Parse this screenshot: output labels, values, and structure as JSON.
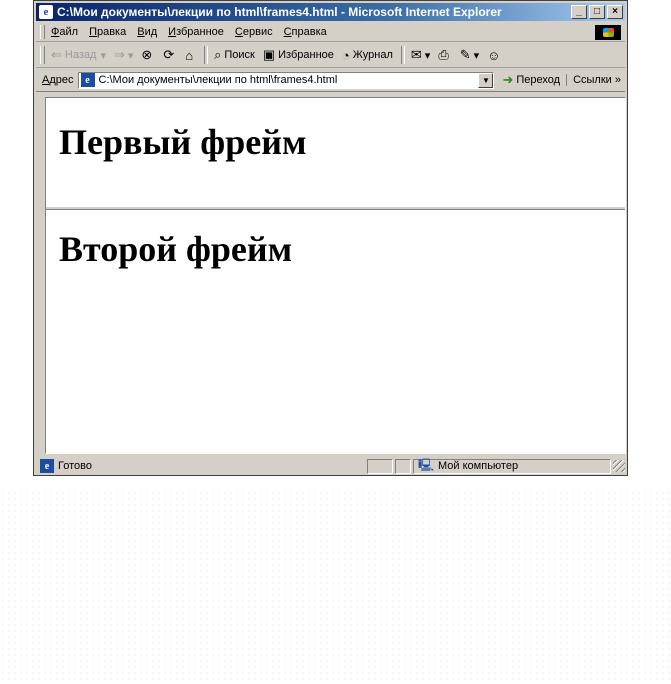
{
  "window": {
    "title": "C:\\Мои документы\\лекции по html\\frames4.html - Microsoft Internet Explorer",
    "controls": {
      "minimize": "_",
      "maximize": "□",
      "close": "×"
    }
  },
  "menu": {
    "items": [
      "Файл",
      "Правка",
      "Вид",
      "Избранное",
      "Сервис",
      "Справка"
    ]
  },
  "toolbar": {
    "back": "Назад",
    "search": "Поиск",
    "favorites": "Избранное",
    "history": "Журнал"
  },
  "address": {
    "label": "Адрес",
    "value": "C:\\Мои документы\\лекции по html\\frames4.html",
    "go": "Переход",
    "links": "Ссылки"
  },
  "frames": {
    "first": "Первый фрейм",
    "second": "Второй фрейм"
  },
  "status": {
    "text": "Готово",
    "zone": "Мой компьютер"
  }
}
